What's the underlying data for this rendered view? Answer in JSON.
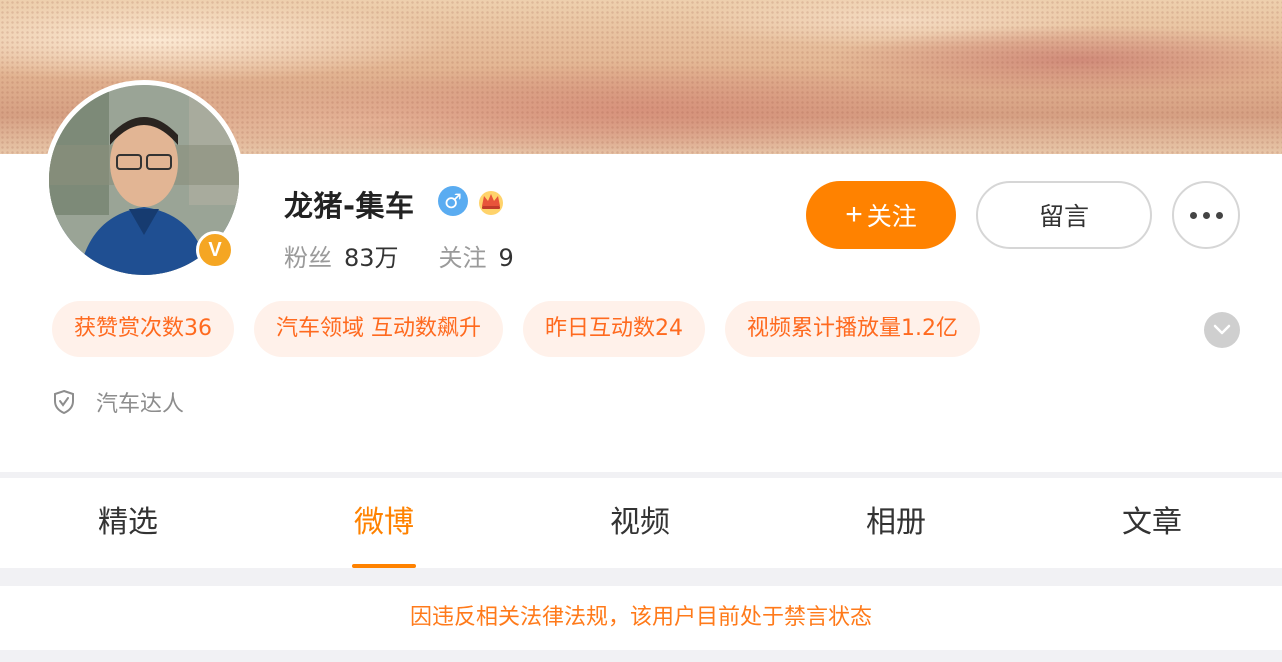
{
  "profile": {
    "name": "龙猪-集车",
    "verified_badge": "V",
    "gender_icon": "male-icon",
    "stats": {
      "fans_label": "粉丝",
      "fans_value": "83万",
      "following_label": "关注",
      "following_value": "9"
    },
    "verification": "汽车达人"
  },
  "actions": {
    "follow_label": "关注",
    "follow_prefix": "+",
    "message_label": "留言"
  },
  "tags": [
    "获赞赏次数36",
    "汽车领域 互动数飙升",
    "昨日互动数24",
    "视频累计播放量1.2亿"
  ],
  "tabs": [
    {
      "label": "精选",
      "active": false
    },
    {
      "label": "微博",
      "active": true
    },
    {
      "label": "视频",
      "active": false
    },
    {
      "label": "相册",
      "active": false
    },
    {
      "label": "文章",
      "active": false
    }
  ],
  "notice": "因违反相关法律法规，该用户目前处于禁言状态",
  "colors": {
    "accent": "#ff8200",
    "tag_bg": "#fff1ea",
    "tag_text": "#ff6a1f",
    "verified_gold": "#f5a623",
    "male_blue": "#5aacf1"
  }
}
